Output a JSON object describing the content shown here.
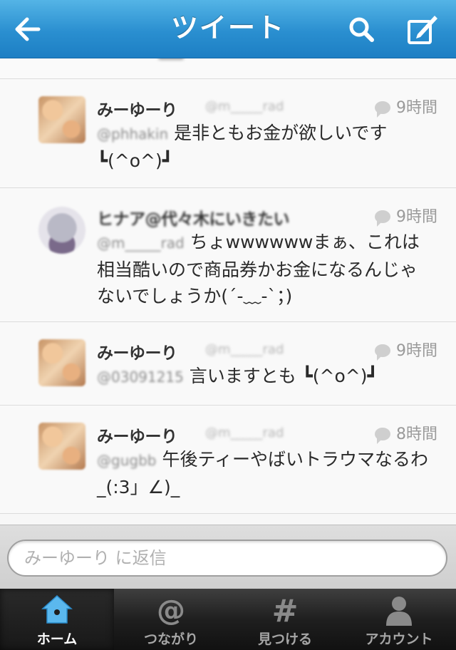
{
  "nav": {
    "title": "ツイート"
  },
  "tweets": [
    {
      "name": "みーゆーり",
      "handle": "@m_____rad",
      "time": "9時間",
      "mention": "@phhakin",
      "text": "是非ともお金が欲しいです ┗(^o^)┛"
    },
    {
      "name": "ヒナア@代々木にいきたい",
      "handle": "",
      "time": "9時間",
      "mention": "@m_____rad",
      "text": "ちょwwwwwwまぁ、これは相当酷いので商品券かお金になるんじゃないでしょうか(´-﹏-`；)"
    },
    {
      "name": "みーゆーり",
      "handle": "@m_____rad",
      "time": "9時間",
      "mention": "@03091215",
      "text": "言いますとも ┗(^o^)┛"
    },
    {
      "name": "みーゆーり",
      "handle": "@m_____rad",
      "time": "8時間",
      "mention": "@gugbb",
      "text": "午後ティーやばいトラウマなるわ_(:3」∠)_"
    }
  ],
  "reply": {
    "placeholder": "みーゆーり に返信"
  },
  "tabs": [
    {
      "label": "ホーム",
      "icon": "home-icon",
      "active": true
    },
    {
      "label": "つながり",
      "icon": "at-icon",
      "active": false
    },
    {
      "label": "見つける",
      "icon": "hash-icon",
      "active": false
    },
    {
      "label": "アカウント",
      "icon": "person-icon",
      "active": false
    }
  ],
  "colors": {
    "nav": "#2a8fd0",
    "tabbar": "#1f1f1f"
  }
}
